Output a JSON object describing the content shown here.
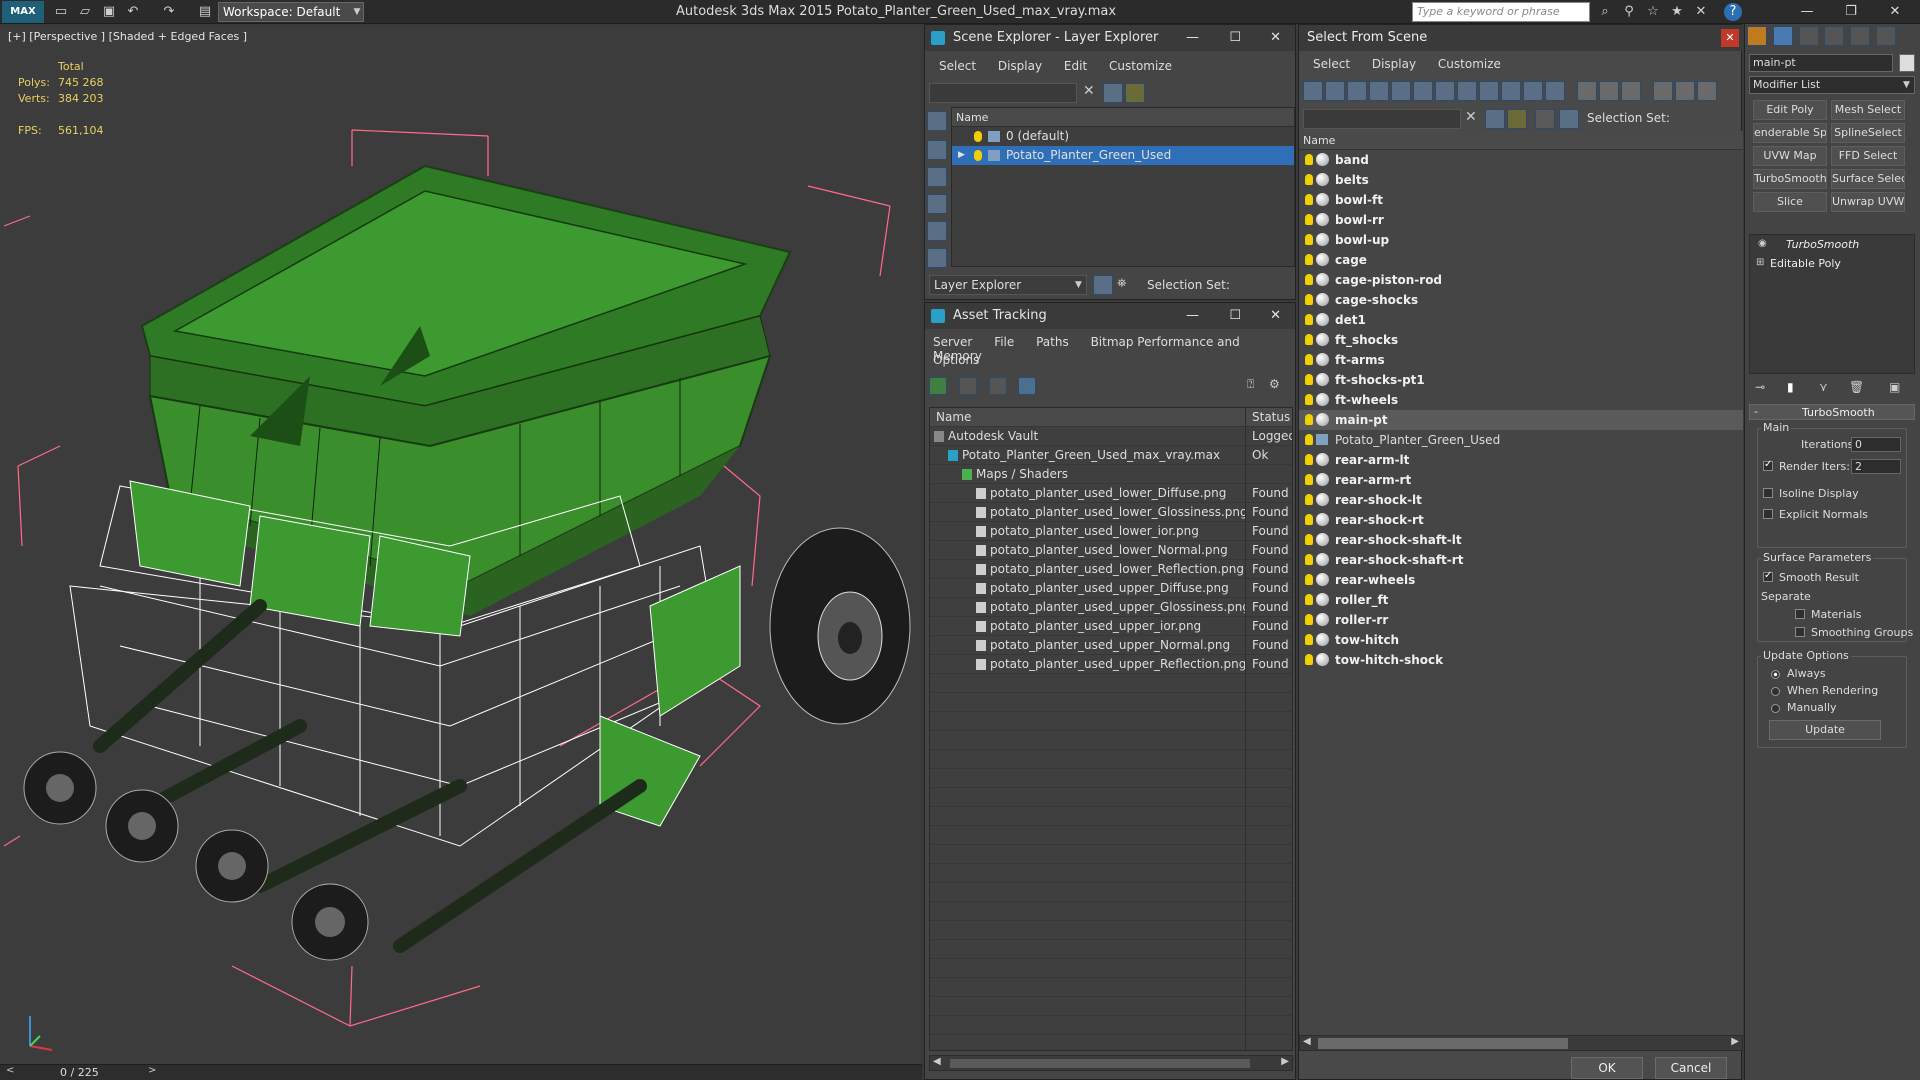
{
  "titlebar": {
    "logo": "MAX",
    "workspace": "Workspace: Default",
    "app_title": "Autodesk 3ds Max  2015     Potato_Planter_Green_Used_max_vray.max",
    "search_placeholder": "Type a keyword or phrase",
    "icons": [
      "new-icon",
      "open-icon",
      "save-icon",
      "undo-icon",
      "redo-icon",
      "project-icon"
    ]
  },
  "viewport": {
    "label": "[+] [Perspective ] [Shaded + Edged Faces ]",
    "stats": {
      "total_label": "Total",
      "polys_label": "Polys:",
      "polys_value": "745 268",
      "verts_label": "Verts:",
      "verts_value": "384 203",
      "fps_label": "FPS:",
      "fps_value": "561,104"
    },
    "timeline_counter": "0 / 225",
    "colors": {
      "model_green": "#3d8f2e",
      "wire": "#ffffff",
      "bbox": "#ff6b8a"
    }
  },
  "scene_explorer": {
    "title": "Scene Explorer - Layer Explorer",
    "menu": [
      "Select",
      "Display",
      "Edit",
      "Customize"
    ],
    "column_name": "Name",
    "layers": [
      {
        "label": "0 (default)",
        "selected": false
      },
      {
        "label": "Potato_Planter_Green_Used",
        "selected": true
      }
    ],
    "bottom_dropdown": "Layer Explorer",
    "selection_set_label": "Selection Set:"
  },
  "asset_tracking": {
    "title": "Asset Tracking",
    "menu": [
      "Server",
      "File",
      "Paths",
      "Bitmap Performance and Memory"
    ],
    "menu2": "Options",
    "columns": {
      "name": "Name",
      "status": "Status"
    },
    "rows": [
      {
        "name": "Autodesk Vault",
        "status": "Logged",
        "indent": 0
      },
      {
        "name": "Potato_Planter_Green_Used_max_vray.max",
        "status": "Ok",
        "indent": 1
      },
      {
        "name": "Maps / Shaders",
        "status": "",
        "indent": 2
      },
      {
        "name": "potato_planter_used_lower_Diffuse.png",
        "status": "Found",
        "indent": 3
      },
      {
        "name": "potato_planter_used_lower_Glossiness.png",
        "status": "Found",
        "indent": 3
      },
      {
        "name": "potato_planter_used_lower_ior.png",
        "status": "Found",
        "indent": 3
      },
      {
        "name": "potato_planter_used_lower_Normal.png",
        "status": "Found",
        "indent": 3
      },
      {
        "name": "potato_planter_used_lower_Reflection.png",
        "status": "Found",
        "indent": 3
      },
      {
        "name": "potato_planter_used_upper_Diffuse.png",
        "status": "Found",
        "indent": 3
      },
      {
        "name": "potato_planter_used_upper_Glossiness.png",
        "status": "Found",
        "indent": 3
      },
      {
        "name": "potato_planter_used_upper_ior.png",
        "status": "Found",
        "indent": 3
      },
      {
        "name": "potato_planter_used_upper_Normal.png",
        "status": "Found",
        "indent": 3
      },
      {
        "name": "potato_planter_used_upper_Reflection.png",
        "status": "Found",
        "indent": 3
      }
    ]
  },
  "select_from_scene": {
    "title": "Select From Scene",
    "menu": [
      "Select",
      "Display",
      "Customize"
    ],
    "selection_set_label": "Selection Set:",
    "column_name": "Name",
    "objects": [
      {
        "label": "band",
        "type": "object"
      },
      {
        "label": "belts",
        "type": "object"
      },
      {
        "label": "bowl-ft",
        "type": "object"
      },
      {
        "label": "bowl-rr",
        "type": "object"
      },
      {
        "label": "bowl-up",
        "type": "object"
      },
      {
        "label": "cage",
        "type": "object"
      },
      {
        "label": "cage-piston-rod",
        "type": "object"
      },
      {
        "label": "cage-shocks",
        "type": "object"
      },
      {
        "label": "det1",
        "type": "object"
      },
      {
        "label": "ft_shocks",
        "type": "object"
      },
      {
        "label": "ft-arms",
        "type": "object"
      },
      {
        "label": "ft-shocks-pt1",
        "type": "object"
      },
      {
        "label": "ft-wheels",
        "type": "object"
      },
      {
        "label": "main-pt",
        "type": "selected"
      },
      {
        "label": "Potato_Planter_Green_Used",
        "type": "layer"
      },
      {
        "label": "rear-arm-lt",
        "type": "object"
      },
      {
        "label": "rear-arm-rt",
        "type": "object"
      },
      {
        "label": "rear-shock-lt",
        "type": "object"
      },
      {
        "label": "rear-shock-rt",
        "type": "object"
      },
      {
        "label": "rear-shock-shaft-lt",
        "type": "object"
      },
      {
        "label": "rear-shock-shaft-rt",
        "type": "object"
      },
      {
        "label": "rear-wheels",
        "type": "object"
      },
      {
        "label": "roller_ft",
        "type": "object"
      },
      {
        "label": "roller-rr",
        "type": "object"
      },
      {
        "label": "tow-hitch",
        "type": "object"
      },
      {
        "label": "tow-hitch-shock",
        "type": "object"
      }
    ],
    "ok_label": "OK",
    "cancel_label": "Cancel"
  },
  "command_panel": {
    "object_name": "main-pt",
    "modifier_list": "Modifier List",
    "buttons": [
      [
        "Edit Poly",
        "Mesh Select"
      ],
      [
        "enderable Spli",
        "SplineSelect"
      ],
      [
        "UVW Map",
        "FFD Select"
      ],
      [
        "TurboSmooth",
        "Surface Select"
      ],
      [
        "Slice",
        "Unwrap UVW"
      ]
    ],
    "stack": [
      "TurboSmooth",
      "Editable Poly"
    ],
    "rollout_title": "TurboSmooth",
    "main_label": "Main",
    "iterations_label": "Iterations:",
    "iterations_value": "0",
    "render_iters_label": "Render Iters:",
    "render_iters_value": "2",
    "isoline_label": "Isoline Display",
    "explicit_normals_label": "Explicit Normals",
    "surface_params_label": "Surface Parameters",
    "smooth_result_label": "Smooth Result",
    "separate_label": "Separate",
    "materials_label": "Materials",
    "smoothing_groups_label": "Smoothing Groups",
    "update_options_label": "Update Options",
    "always_label": "Always",
    "when_rendering_label": "When Rendering",
    "manually_label": "Manually",
    "update_button": "Update"
  }
}
